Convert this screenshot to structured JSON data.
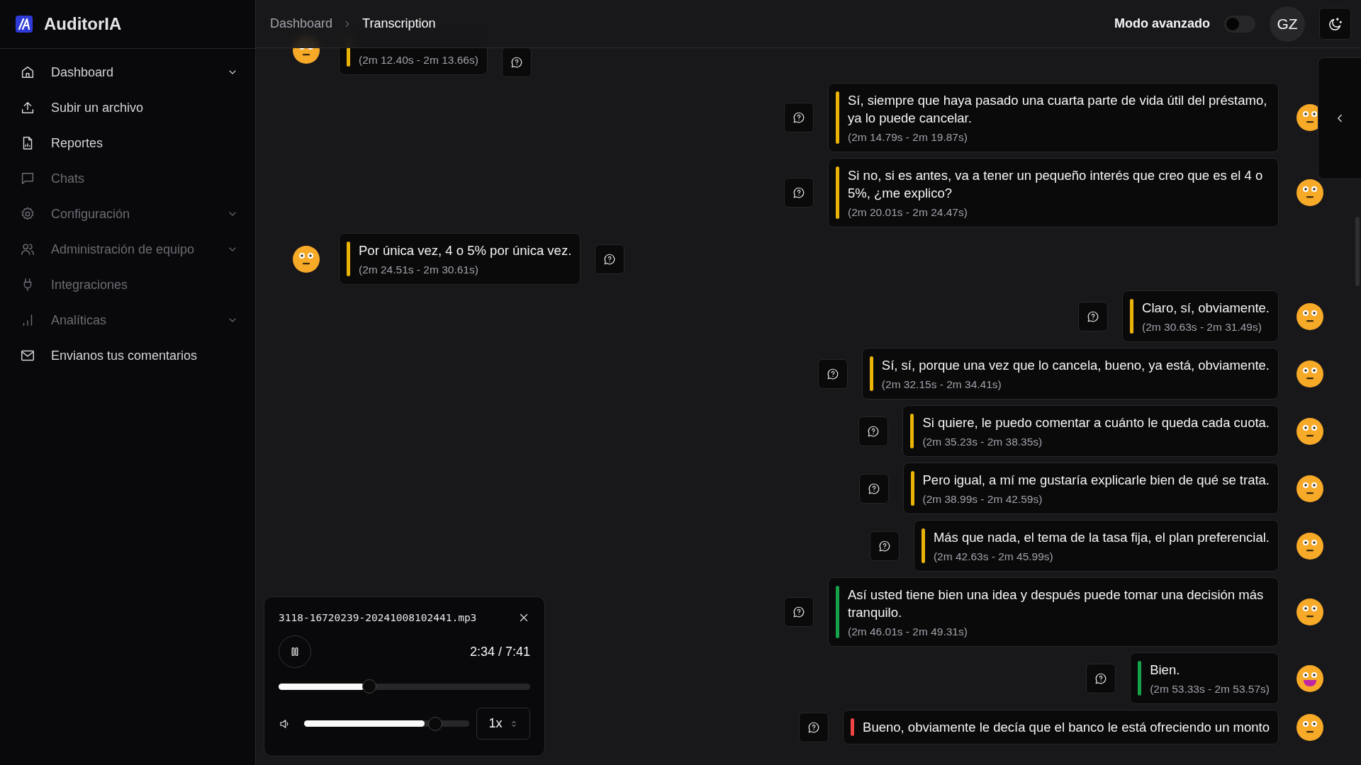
{
  "app": {
    "name": "AuditorIA"
  },
  "sidebar": {
    "items": [
      {
        "label": "Dashboard",
        "disabled": false,
        "expandable": true
      },
      {
        "label": "Subir un archivo",
        "disabled": false,
        "expandable": false
      },
      {
        "label": "Reportes",
        "disabled": false,
        "expandable": false
      },
      {
        "label": "Chats",
        "disabled": true,
        "expandable": false
      },
      {
        "label": "Configuración",
        "disabled": true,
        "expandable": true
      },
      {
        "label": "Administración de equipo",
        "disabled": true,
        "expandable": true
      },
      {
        "label": "Integraciones",
        "disabled": true,
        "expandable": false
      },
      {
        "label": "Analíticas",
        "disabled": true,
        "expandable": true
      },
      {
        "label": "Envianos tus comentarios",
        "disabled": false,
        "expandable": false
      }
    ]
  },
  "breadcrumb": [
    "Dashboard",
    "Transcription"
  ],
  "header": {
    "advanced_mode_label": "Modo avanzado",
    "advanced_mode_on": false,
    "user_initials": "GZ"
  },
  "messages": [
    {
      "kind": "left",
      "color": "#eab308",
      "happy": false,
      "time": "(2m 12.40s - 2m 13.66s)"
    },
    {
      "kind": "right",
      "color": "#eab308",
      "happy": false,
      "text": "Sí, siempre que haya pasado una cuarta parte de vida útil del préstamo, ya lo puede cancelar.",
      "time": "(2m 14.79s - 2m 19.87s)"
    },
    {
      "kind": "right",
      "color": "#eab308",
      "happy": false,
      "text": "Si no, si es antes, va a tener un pequeño interés que creo que es el 4 o 5%, ¿me explico?",
      "time": "(2m 20.01s - 2m 24.47s)"
    },
    {
      "kind": "left",
      "color": "#eab308",
      "happy": false,
      "text": "Por única vez, 4 o 5% por única vez.",
      "time": "(2m 24.51s - 2m 30.61s)"
    },
    {
      "kind": "right",
      "color": "#eab308",
      "happy": false,
      "text": "Claro, sí, obviamente.",
      "time": "(2m 30.63s - 2m 31.49s)"
    },
    {
      "kind": "right",
      "color": "#eab308",
      "happy": false,
      "text": "Sí, sí, porque una vez que lo cancela, bueno, ya está, obviamente.",
      "time": "(2m 32.15s - 2m 34.41s)"
    },
    {
      "kind": "right",
      "color": "#eab308",
      "happy": false,
      "text": "Si quiere, le puedo comentar a cuánto le queda cada cuota.",
      "time": "(2m 35.23s - 2m 38.35s)"
    },
    {
      "kind": "right",
      "color": "#eab308",
      "happy": false,
      "text": "Pero igual, a mí me gustaría explicarle bien de qué se trata.",
      "time": "(2m 38.99s - 2m 42.59s)"
    },
    {
      "kind": "right",
      "color": "#eab308",
      "happy": false,
      "text": "Más que nada, el tema de la tasa fija, el plan preferencial.",
      "time": "(2m 42.63s - 2m 45.99s)"
    },
    {
      "kind": "right",
      "color": "#16a34a",
      "happy": false,
      "text": "Así usted tiene bien una idea y después puede tomar una decisión más tranquilo.",
      "time": "(2m 46.01s - 2m 49.31s)"
    },
    {
      "kind": "right",
      "color": "#16a34a",
      "happy": true,
      "text": "Bien.",
      "time": "(2m 53.33s - 2m 53.57s)"
    },
    {
      "kind": "right",
      "color": "#ef4444",
      "happy": false,
      "text": "Bueno, obviamente le decía que el banco le está ofreciendo un monto"
    }
  ],
  "player": {
    "file": "3118-16720239-20241008102441.mp3",
    "playing": true,
    "time": "2:34 / 7:41",
    "level": 0.34,
    "volume": {
      "level": 0.73
    },
    "speed": "1x"
  }
}
